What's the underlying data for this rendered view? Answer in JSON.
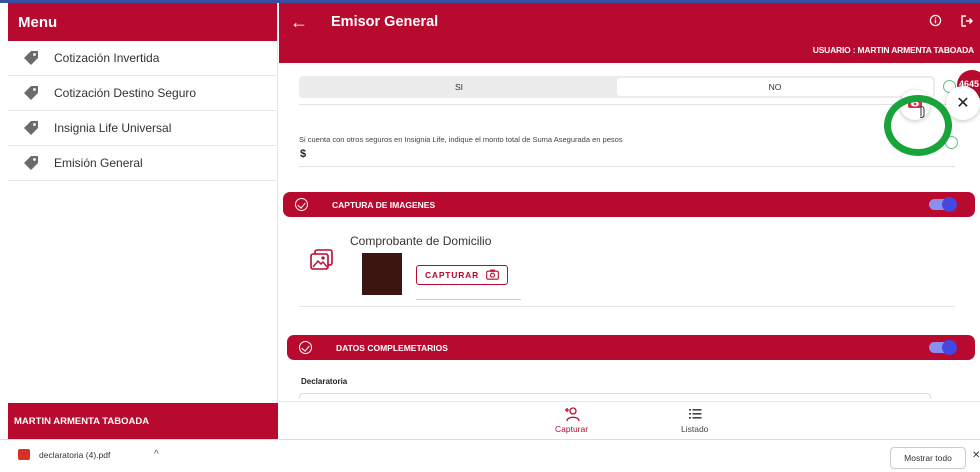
{
  "menu": {
    "title": "Menu",
    "items": [
      {
        "label": "Cotización Invertida",
        "icon": "tag-icon"
      },
      {
        "label": "Cotización Destino Seguro",
        "icon": "tag-icon"
      },
      {
        "label": "Insignia Life Universal",
        "icon": "tag-icon"
      },
      {
        "label": "Emisión General",
        "icon": "tag-icon"
      }
    ],
    "footer_user": "MARTIN ARMENTA TABOADA"
  },
  "header": {
    "title": "Emisor General",
    "user_line": "USUARIO : MARTIN ARMENTA TABOADA"
  },
  "form": {
    "options": {
      "yes": "SI",
      "no": "NO",
      "selected": "NO"
    },
    "question": "Si cuenta con otros seguros en Insignia Life, indique el monto total de Suma Asegurada en pesos",
    "amount_symbol": "$"
  },
  "sections": {
    "images": {
      "title": "CAPTURA DE IMAGENES",
      "document_label": "Comprobante de Domicilio",
      "capture_button": "CAPTURAR"
    },
    "complementary": {
      "title": "DATOS COMPLEMETARIOS",
      "field_label": "Declaratoria"
    }
  },
  "bottom_nav": {
    "capture": "Capturar",
    "list": "Listado"
  },
  "floating": {
    "badge": "4645"
  },
  "downloads": {
    "file": "declaratoria (4).pdf",
    "show_all": "Mostrar todo"
  },
  "colors": {
    "brand": "#b8092f",
    "toggle_on": "#4448e0",
    "check": "#5cc08c",
    "highlight_ring": "#19a33b"
  }
}
